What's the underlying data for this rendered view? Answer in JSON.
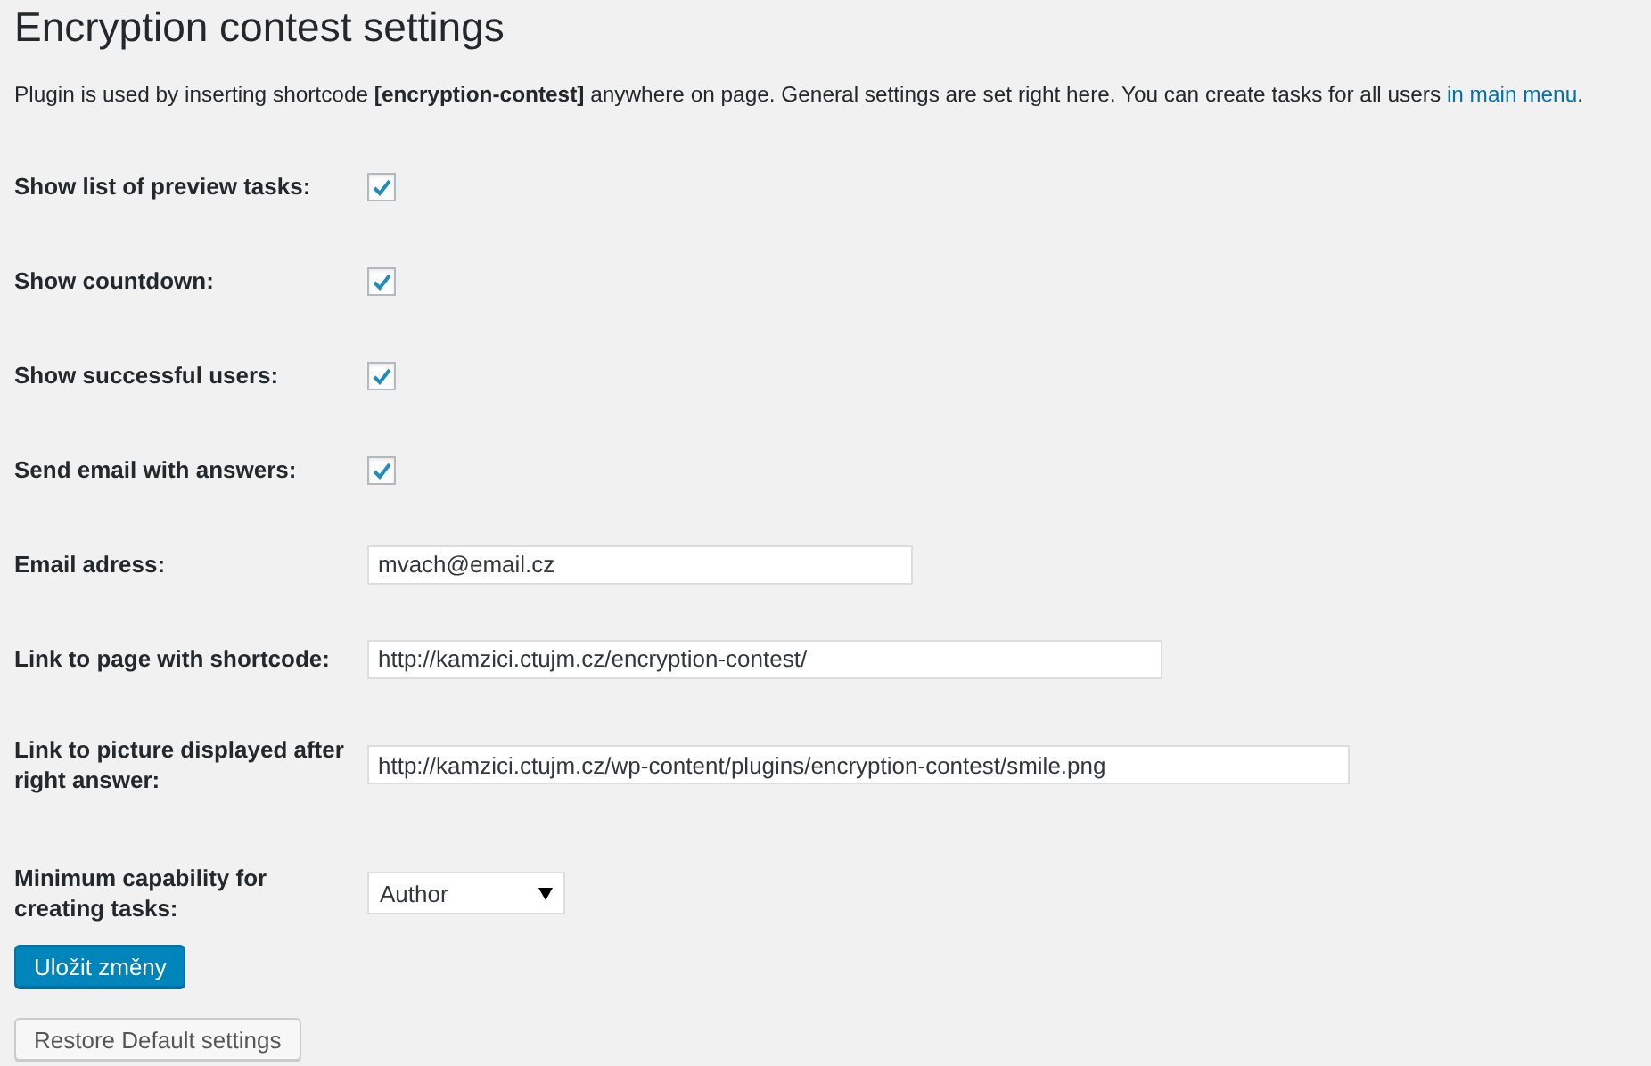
{
  "title": "Encryption contest settings",
  "intro": {
    "text": "Plugin is used by inserting shortcode **[encryption-contest]** anywhere on page. General settings are set right here. You can create tasks for all users",
    "link": "in main menu",
    "suffix": "."
  },
  "settings": [
    {
      "kind": "checkbox",
      "label": "Show list of preview tasks:",
      "checked": true
    },
    {
      "kind": "checkbox",
      "label": "Show countdown:",
      "checked": true
    },
    {
      "kind": "checkbox",
      "label": "Show successful users:",
      "checked": true
    },
    {
      "kind": "checkbox",
      "label": "Send email with answers:",
      "checked": true
    },
    {
      "kind": "text",
      "label": "Email adress:",
      "value": "mvach@email.cz"
    },
    {
      "kind": "text",
      "label": "Link to page with shortcode:",
      "value": "http://kamzici.ctujm.cz/encryption-contest/"
    },
    {
      "kind": "text",
      "label": "Link to picture displayed after right answer:",
      "value": "http://kamzici.ctujm.cz/wp-content/plugins/encryption-contest/smile.png"
    },
    {
      "kind": "select",
      "label": "Minimum capability for creating tasks:",
      "value": "Author"
    }
  ],
  "buttons": [
    {
      "kind": "primary",
      "label": "Uložit změny"
    },
    {
      "kind": "secondary",
      "label": "Restore Default settings"
    }
  ]
}
